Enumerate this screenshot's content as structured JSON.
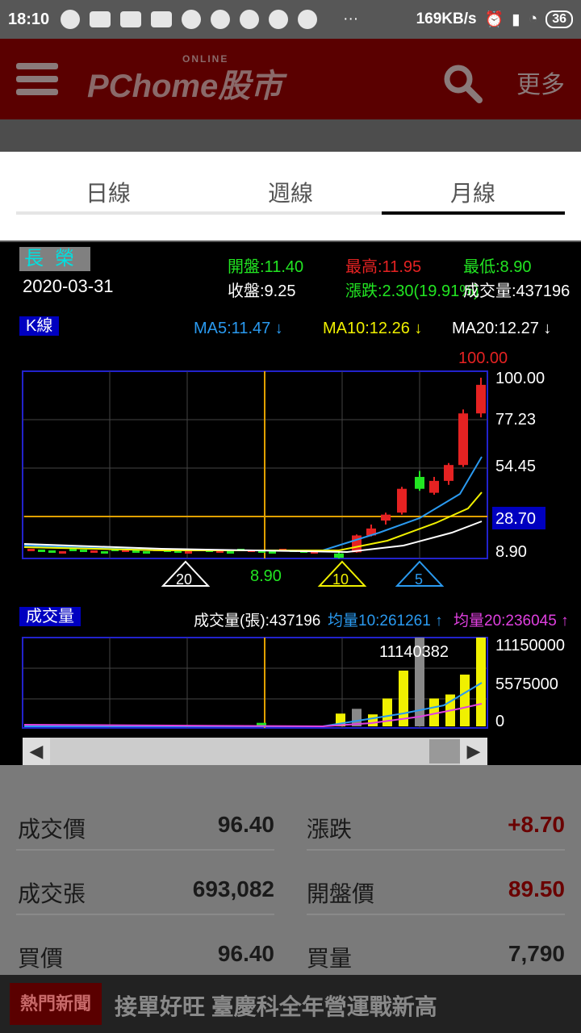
{
  "status_bar": {
    "time": "18:10",
    "dots": "···",
    "net_speed": "169KB/s",
    "battery": "36"
  },
  "header": {
    "logo_small": "ONLINE",
    "logo": "PChome股市",
    "more": "更多"
  },
  "tabs": [
    {
      "label": "日線"
    },
    {
      "label": "週線"
    },
    {
      "label": "月線"
    }
  ],
  "stock": {
    "name": "長榮",
    "date": "2020-03-31",
    "open": "開盤:11.40",
    "high": "最高:11.95",
    "low": "最低:8.90",
    "close": "收盤:9.25",
    "change": "漲跌:2.30(19.91%)",
    "volume": "成交量:437196"
  },
  "kline": {
    "label": "K線",
    "ma5": "MA5:11.47 ↓",
    "ma10": "MA10:12.26 ↓",
    "ma20": "MA20:12.27 ↓",
    "max_label": "100.00",
    "low_label": "8.90",
    "cursor_price": "28.70",
    "ticks": [
      "100.00",
      "77.23",
      "54.45",
      "8.90"
    ],
    "markers": [
      "20",
      "10",
      "5"
    ]
  },
  "volume_chart": {
    "label": "成交量",
    "vol": "成交量(張):437196",
    "avg10": "均量10:261261 ↑",
    "avg20": "均量20:236045 ↑",
    "max_label": "11140382",
    "ticks": [
      "11150000",
      "5575000",
      "0"
    ]
  },
  "chart_data": [
    {
      "type": "candlestick",
      "title": "K線",
      "ylim": [
        8.9,
        100.0
      ],
      "candles": [
        {
          "open": 11.4,
          "close": 9.25,
          "high": 11.95,
          "low": 8.9
        },
        {
          "open": 12.0,
          "close": 20.5,
          "high": 21.0,
          "low": 11.8
        },
        {
          "open": 20.5,
          "close": 24.0,
          "high": 26.0,
          "low": 20.0
        },
        {
          "open": 28.0,
          "close": 31.0,
          "high": 32.0,
          "low": 26.0
        },
        {
          "open": 32.0,
          "close": 44.0,
          "high": 45.0,
          "low": 31.0
        },
        {
          "open": 50.0,
          "close": 44.0,
          "high": 53.0,
          "low": 43.0
        },
        {
          "open": 42.0,
          "close": 48.0,
          "high": 50.0,
          "low": 41.0
        },
        {
          "open": 48.0,
          "close": 56.0,
          "high": 57.0,
          "low": 46.0
        },
        {
          "open": 56.0,
          "close": 82.0,
          "high": 84.0,
          "low": 55.0
        },
        {
          "open": 82.0,
          "close": 96.4,
          "high": 100.0,
          "low": 80.0
        }
      ]
    },
    {
      "type": "bar",
      "title": "成交量",
      "ylim": [
        0,
        11150000
      ],
      "values": [
        437196,
        1600000,
        2200000,
        1500000,
        3500000,
        7000000,
        11140382,
        3500000,
        4000000,
        6500000,
        11150000
      ]
    }
  ],
  "quote": {
    "left": [
      {
        "label": "成交價",
        "value": "96.40"
      },
      {
        "label": "成交張",
        "value": "693,082"
      },
      {
        "label": "買價",
        "value": "96.40"
      }
    ],
    "right": [
      {
        "label": "漲跌",
        "value": "+8.70"
      },
      {
        "label": "開盤價",
        "value": "89.50"
      },
      {
        "label": "買量",
        "value": "7,790"
      }
    ]
  },
  "news": {
    "tag": "熱門新聞",
    "headline": "接單好旺 臺慶科全年營運戰新高"
  }
}
